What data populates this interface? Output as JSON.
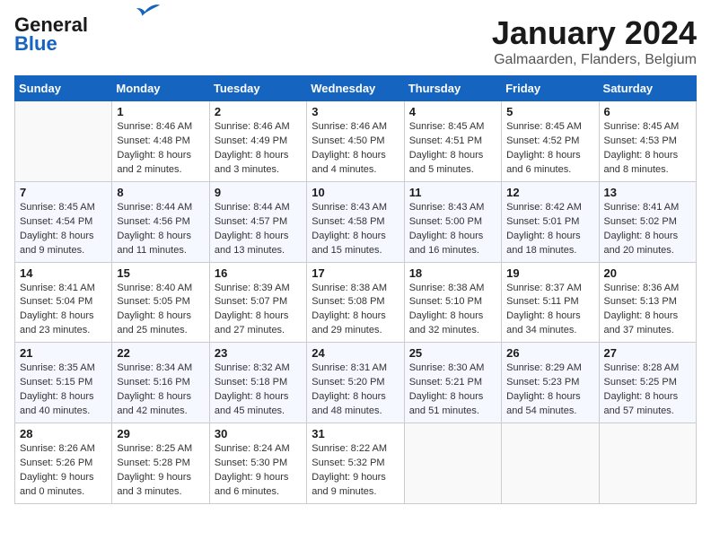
{
  "logo": {
    "line1": "General",
    "line2": "Blue"
  },
  "title": "January 2024",
  "subtitle": "Galmaarden, Flanders, Belgium",
  "headers": [
    "Sunday",
    "Monday",
    "Tuesday",
    "Wednesday",
    "Thursday",
    "Friday",
    "Saturday"
  ],
  "weeks": [
    [
      {
        "day": "",
        "info": ""
      },
      {
        "day": "1",
        "info": "Sunrise: 8:46 AM\nSunset: 4:48 PM\nDaylight: 8 hours\nand 2 minutes."
      },
      {
        "day": "2",
        "info": "Sunrise: 8:46 AM\nSunset: 4:49 PM\nDaylight: 8 hours\nand 3 minutes."
      },
      {
        "day": "3",
        "info": "Sunrise: 8:46 AM\nSunset: 4:50 PM\nDaylight: 8 hours\nand 4 minutes."
      },
      {
        "day": "4",
        "info": "Sunrise: 8:45 AM\nSunset: 4:51 PM\nDaylight: 8 hours\nand 5 minutes."
      },
      {
        "day": "5",
        "info": "Sunrise: 8:45 AM\nSunset: 4:52 PM\nDaylight: 8 hours\nand 6 minutes."
      },
      {
        "day": "6",
        "info": "Sunrise: 8:45 AM\nSunset: 4:53 PM\nDaylight: 8 hours\nand 8 minutes."
      }
    ],
    [
      {
        "day": "7",
        "info": "Sunrise: 8:45 AM\nSunset: 4:54 PM\nDaylight: 8 hours\nand 9 minutes."
      },
      {
        "day": "8",
        "info": "Sunrise: 8:44 AM\nSunset: 4:56 PM\nDaylight: 8 hours\nand 11 minutes."
      },
      {
        "day": "9",
        "info": "Sunrise: 8:44 AM\nSunset: 4:57 PM\nDaylight: 8 hours\nand 13 minutes."
      },
      {
        "day": "10",
        "info": "Sunrise: 8:43 AM\nSunset: 4:58 PM\nDaylight: 8 hours\nand 15 minutes."
      },
      {
        "day": "11",
        "info": "Sunrise: 8:43 AM\nSunset: 5:00 PM\nDaylight: 8 hours\nand 16 minutes."
      },
      {
        "day": "12",
        "info": "Sunrise: 8:42 AM\nSunset: 5:01 PM\nDaylight: 8 hours\nand 18 minutes."
      },
      {
        "day": "13",
        "info": "Sunrise: 8:41 AM\nSunset: 5:02 PM\nDaylight: 8 hours\nand 20 minutes."
      }
    ],
    [
      {
        "day": "14",
        "info": "Sunrise: 8:41 AM\nSunset: 5:04 PM\nDaylight: 8 hours\nand 23 minutes."
      },
      {
        "day": "15",
        "info": "Sunrise: 8:40 AM\nSunset: 5:05 PM\nDaylight: 8 hours\nand 25 minutes."
      },
      {
        "day": "16",
        "info": "Sunrise: 8:39 AM\nSunset: 5:07 PM\nDaylight: 8 hours\nand 27 minutes."
      },
      {
        "day": "17",
        "info": "Sunrise: 8:38 AM\nSunset: 5:08 PM\nDaylight: 8 hours\nand 29 minutes."
      },
      {
        "day": "18",
        "info": "Sunrise: 8:38 AM\nSunset: 5:10 PM\nDaylight: 8 hours\nand 32 minutes."
      },
      {
        "day": "19",
        "info": "Sunrise: 8:37 AM\nSunset: 5:11 PM\nDaylight: 8 hours\nand 34 minutes."
      },
      {
        "day": "20",
        "info": "Sunrise: 8:36 AM\nSunset: 5:13 PM\nDaylight: 8 hours\nand 37 minutes."
      }
    ],
    [
      {
        "day": "21",
        "info": "Sunrise: 8:35 AM\nSunset: 5:15 PM\nDaylight: 8 hours\nand 40 minutes."
      },
      {
        "day": "22",
        "info": "Sunrise: 8:34 AM\nSunset: 5:16 PM\nDaylight: 8 hours\nand 42 minutes."
      },
      {
        "day": "23",
        "info": "Sunrise: 8:32 AM\nSunset: 5:18 PM\nDaylight: 8 hours\nand 45 minutes."
      },
      {
        "day": "24",
        "info": "Sunrise: 8:31 AM\nSunset: 5:20 PM\nDaylight: 8 hours\nand 48 minutes."
      },
      {
        "day": "25",
        "info": "Sunrise: 8:30 AM\nSunset: 5:21 PM\nDaylight: 8 hours\nand 51 minutes."
      },
      {
        "day": "26",
        "info": "Sunrise: 8:29 AM\nSunset: 5:23 PM\nDaylight: 8 hours\nand 54 minutes."
      },
      {
        "day": "27",
        "info": "Sunrise: 8:28 AM\nSunset: 5:25 PM\nDaylight: 8 hours\nand 57 minutes."
      }
    ],
    [
      {
        "day": "28",
        "info": "Sunrise: 8:26 AM\nSunset: 5:26 PM\nDaylight: 9 hours\nand 0 minutes."
      },
      {
        "day": "29",
        "info": "Sunrise: 8:25 AM\nSunset: 5:28 PM\nDaylight: 9 hours\nand 3 minutes."
      },
      {
        "day": "30",
        "info": "Sunrise: 8:24 AM\nSunset: 5:30 PM\nDaylight: 9 hours\nand 6 minutes."
      },
      {
        "day": "31",
        "info": "Sunrise: 8:22 AM\nSunset: 5:32 PM\nDaylight: 9 hours\nand 9 minutes."
      },
      {
        "day": "",
        "info": ""
      },
      {
        "day": "",
        "info": ""
      },
      {
        "day": "",
        "info": ""
      }
    ]
  ]
}
